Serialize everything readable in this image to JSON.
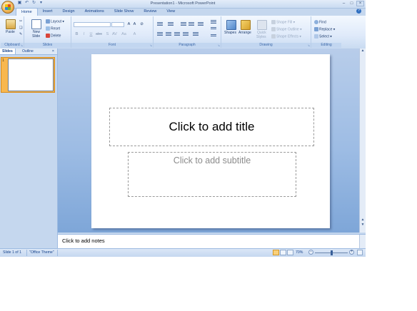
{
  "window": {
    "title": "Presentation1 - Microsoft PowerPoint"
  },
  "quick_access": [
    "save-icon",
    "undo-icon",
    "redo-icon",
    "customize-icon"
  ],
  "tabs": [
    {
      "label": "Home",
      "active": true
    },
    {
      "label": "Insert",
      "active": false
    },
    {
      "label": "Design",
      "active": false
    },
    {
      "label": "Animations",
      "active": false
    },
    {
      "label": "Slide Show",
      "active": false
    },
    {
      "label": "Review",
      "active": false
    },
    {
      "label": "View",
      "active": false
    }
  ],
  "ribbon": {
    "clipboard": {
      "label": "Clipboard",
      "paste": "Paste"
    },
    "slides": {
      "label": "Slides",
      "new_slide_1": "New",
      "new_slide_2": "Slide",
      "layout": "Layout",
      "reset": "Reset",
      "delete": "Delete"
    },
    "font": {
      "label": "Font",
      "font_name": "",
      "font_size": ""
    },
    "paragraph": {
      "label": "Paragraph"
    },
    "drawing": {
      "label": "Drawing",
      "shapes": "Shapes",
      "arrange": "Arrange",
      "quick_styles_1": "Quick",
      "quick_styles_2": "Styles",
      "shape_fill": "Shape Fill",
      "shape_outline": "Shape Outline",
      "shape_effects": "Shape Effects"
    },
    "editing": {
      "label": "Editing",
      "find": "Find",
      "replace": "Replace",
      "select": "Select"
    }
  },
  "pane": {
    "tab_slides": "Slides",
    "tab_outline": "Outline",
    "close": "×",
    "thumb_number": "1"
  },
  "slide": {
    "title_placeholder": "Click to add title",
    "subtitle_placeholder": "Click to add subtitle"
  },
  "notes": {
    "placeholder": "Click to add notes"
  },
  "status": {
    "slide_info": "Slide 1 of 1",
    "theme": "\"Office Theme\"",
    "zoom": "70%",
    "zoom_level": 0.5
  },
  "colors": {
    "accent": "#15428b",
    "selected_thumb": "#f8b74e",
    "ribbon_bg": "#dfeafa"
  }
}
